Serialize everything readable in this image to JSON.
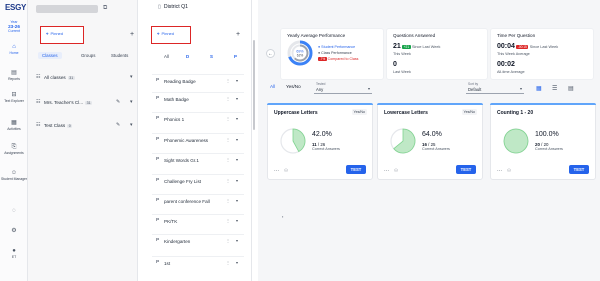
{
  "brand": {
    "logo_text": "ESGY"
  },
  "year": {
    "label": "Year",
    "value": "23-26",
    "status": "Current"
  },
  "nav": {
    "home": "Home",
    "reports": "Reports",
    "text_explorer": "Text Explorer",
    "activities": "Activities",
    "assignments": "Assignments",
    "student_manager": "Student Manager",
    "user_initials": "ET"
  },
  "classes_panel": {
    "pinned_label": "Pinned",
    "tabs": [
      "Classes",
      "Groups",
      "Students"
    ],
    "rows": [
      {
        "name": "All classes",
        "count": "31"
      },
      {
        "name": "Mrs. Teacher's Cl...",
        "count": "31"
      },
      {
        "name": "Test Class",
        "count": "0"
      }
    ]
  },
  "list_panel": {
    "title": "District Q1",
    "pinned_label": "Pinned",
    "filters": [
      "All",
      "D",
      "S",
      "P"
    ],
    "items": [
      "Reading Badge",
      "Math Badge",
      "Phonics 1",
      "Phonemic Awareness",
      "Sight Words Gr.1",
      "Challenge Fry List",
      "parent conference Fall",
      "PK/TK",
      "Kindergarten",
      "1st"
    ],
    "item_prefix": "P"
  },
  "stats": {
    "yearly": {
      "title": "Yearly Average Performance",
      "student_pct": "69%",
      "class_pct": "62%",
      "legend_student": "Student Performance",
      "legend_class": "Class Performance",
      "compare_badge": "-7%",
      "compare_text": "Compared to Class"
    },
    "questions": {
      "title": "Questions Answered",
      "this_week_value": "21",
      "this_week_badge": "+21",
      "this_week_since": "Since Last Week",
      "this_week_label": "This Week",
      "last_week_value": "0",
      "last_week_label": "Last Week"
    },
    "time": {
      "title": "Time Per Question",
      "this_week_value": "00:04",
      "this_week_badge": "-00:15",
      "this_week_since": "Since Last Week",
      "this_week_label": "This Week Average",
      "all_time_value": "00:02",
      "all_time_label": "All-time Average"
    }
  },
  "filters_bar": {
    "tab_all": "All",
    "tab_yesno": "Yes/No",
    "tested_label": "Tested",
    "tested_value": "Any",
    "sort_label": "Sort by",
    "sort_value": "Default"
  },
  "cards": [
    {
      "title": "Uppercase Letters",
      "tag": "Yes/No",
      "percent": "42.0%",
      "progress": 0.42,
      "count": "11",
      "total": "26",
      "caption": "Correct Answers",
      "button": "TEST"
    },
    {
      "title": "Lowercase Letters",
      "tag": "Yes/No",
      "percent": "64.0%",
      "progress": 0.64,
      "count": "16",
      "total": "25",
      "caption": "Correct Answers",
      "button": "TEST"
    },
    {
      "title": "Counting 1 - 20",
      "tag": "",
      "percent": "100.0%",
      "progress": 1.0,
      "count": "20",
      "total": "20",
      "caption": "Correct Answers",
      "button": "TEST"
    }
  ],
  "colors": {
    "accent": "#2563eb",
    "pinned_border": "#dc2626",
    "ring": "#7fd48f"
  }
}
